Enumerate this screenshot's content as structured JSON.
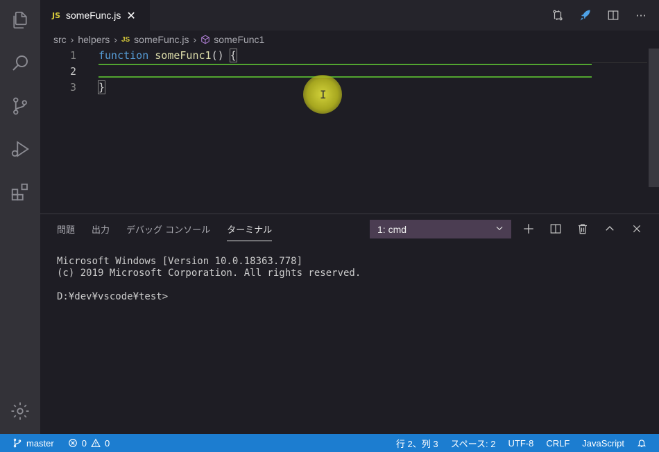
{
  "tab": {
    "badge": "JS",
    "name": "someFunc.js",
    "close": "✕"
  },
  "breadcrumb": {
    "folder1": "src",
    "folder2": "helpers",
    "file_badge": "JS",
    "file": "someFunc.js",
    "symbol": "someFunc1"
  },
  "editor": {
    "lines": [
      {
        "num": "1",
        "keyword": "function",
        "name": "someFunc1",
        "rest": "() ",
        "brace": "{"
      },
      {
        "num": "2"
      },
      {
        "num": "3",
        "brace": "}"
      }
    ]
  },
  "panel": {
    "tabs": [
      "問題",
      "出力",
      "デバッグ コンソール",
      "ターミナル"
    ],
    "terminal_select": "1: cmd",
    "terminal_lines": [
      "Microsoft Windows [Version 10.0.18363.778]",
      "(c) 2019 Microsoft Corporation. All rights reserved.",
      "",
      "D:¥dev¥vscode¥test>"
    ]
  },
  "status": {
    "branch": "master",
    "errors": "0",
    "warnings": "0",
    "position": "行 2、列 3",
    "spaces": "スペース: 2",
    "encoding": "UTF-8",
    "eol": "CRLF",
    "language": "JavaScript"
  },
  "colors": {
    "statusbar": "#1c7dd0",
    "activitybar": "#333238",
    "editor_bg": "#1e1d24",
    "accent_line": "#52a530",
    "terminal_select_bg": "#4b3d52"
  }
}
